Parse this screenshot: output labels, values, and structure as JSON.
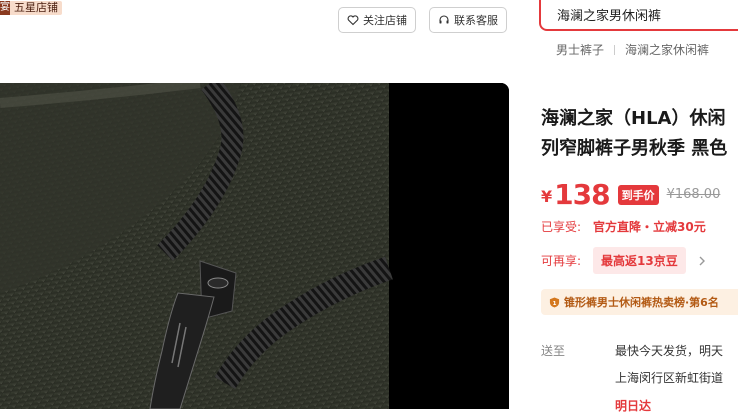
{
  "store": {
    "icon_char": "宴",
    "badge": "五星店铺"
  },
  "actions": {
    "follow": "关注店铺",
    "service": "联系客服"
  },
  "search": {
    "value": "海澜之家男休闲裤"
  },
  "hot_links": [
    "男士裤子",
    "海澜之家休闲裤"
  ],
  "product": {
    "title_line1": "海澜之家（HLA）休闲",
    "title_line2": "列窄脚裤子男秋季 黑色",
    "currency": "¥",
    "price": "138",
    "price_tag": "到手价",
    "original_price": "¥168.00",
    "enjoyed_label": "已享受:",
    "enjoyed_value": "官方直降・立减30元",
    "can_enjoy_label": "可再享:",
    "can_enjoy_value": "最高返13京豆",
    "rank": "锥形裤男士休闲裤热卖榜·第6名",
    "ship_label": "送至",
    "ship_line1": "最快今天发货，明天",
    "ship_line2": "上海闵行区新虹街道",
    "ship_line3": "明日达"
  },
  "colors": {
    "accent": "#e4393c",
    "rank_bg": "#fdf0e2",
    "rank_text": "#b35a14"
  }
}
